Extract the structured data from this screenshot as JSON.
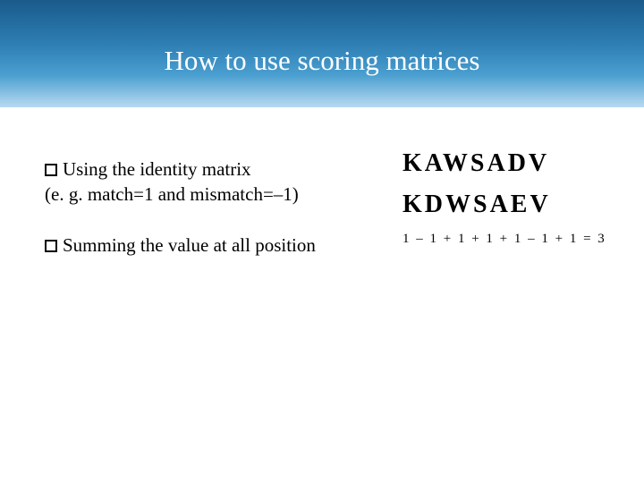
{
  "title": "How to use scoring matrices",
  "bullets": {
    "item1_line1": "Using the identity matrix",
    "item1_line2": "(e. g. match=1 and mismatch=–1)",
    "item2": "Summing the value at all position"
  },
  "sequences": {
    "seq1": "KAWSADV",
    "seq2": "KDWSAEV"
  },
  "calculation": "1 – 1 + 1 + 1 + 1 – 1 + 1 = 3"
}
